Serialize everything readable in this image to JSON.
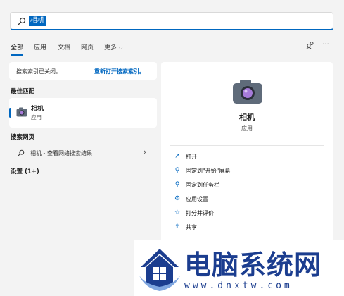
{
  "search": {
    "value": "相机"
  },
  "tabs": [
    {
      "label": "全部"
    },
    {
      "label": "应用"
    },
    {
      "label": "文档"
    },
    {
      "label": "网页"
    },
    {
      "label": "更多"
    }
  ],
  "left": {
    "notice": {
      "text": "搜索索引已关闭。",
      "link": "重新打开搜索索引。"
    },
    "best_match_title": "最佳匹配",
    "best_match": {
      "name": "相机",
      "type": "应用"
    },
    "web_title": "搜索网页",
    "web_item": "相机 - 查看网络搜索结果",
    "settings_title": "设置 (1+)"
  },
  "right": {
    "app_name": "相机",
    "app_type": "应用",
    "actions": [
      {
        "icon": "open-icon",
        "label": "打开"
      },
      {
        "icon": "pin-icon",
        "label": "固定到\"开始\"屏幕"
      },
      {
        "icon": "pin-icon",
        "label": "固定到任务栏"
      },
      {
        "icon": "gear-icon",
        "label": "应用设置"
      },
      {
        "icon": "star-icon",
        "label": "打分并评价"
      },
      {
        "icon": "share-icon",
        "label": "共享"
      }
    ]
  },
  "watermark": {
    "title": "电脑系统网",
    "url": "www.dnxtw.com"
  },
  "colors": {
    "accent": "#0067c0",
    "watermark": "#1b3d8f"
  }
}
